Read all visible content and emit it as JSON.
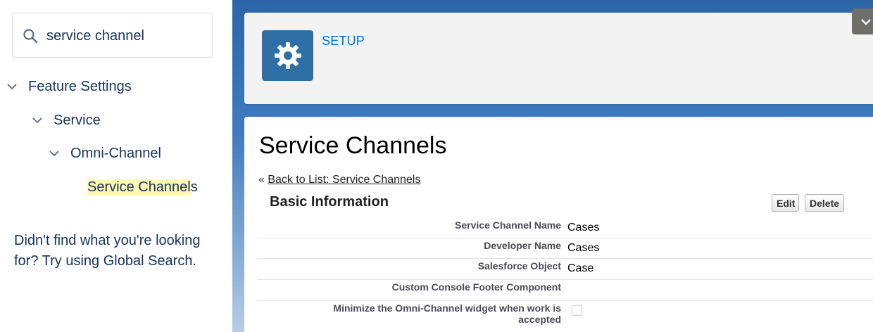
{
  "sidebar": {
    "search": {
      "value": "service channel",
      "placeholder": ""
    },
    "tree": {
      "level1": "Feature Settings",
      "level2": "Service",
      "level3": "Omni-Channel",
      "leaf_highlight": "Service Channel",
      "leaf_rest": "s"
    },
    "help_text": "Didn't find what you're looking for? Try using Global Search."
  },
  "header": {
    "setup_label": "SETUP"
  },
  "content": {
    "page_title": "Service Channels",
    "back_prefix": "« ",
    "back_link": "Back to List: Service Channels",
    "section_title": "Basic Information",
    "edit_label": "Edit",
    "delete_label": "Delete",
    "fields": [
      {
        "label": "Service Channel Name",
        "value": "Cases"
      },
      {
        "label": "Developer Name",
        "value": "Cases"
      },
      {
        "label": "Salesforce Object",
        "value": "Case"
      },
      {
        "label": "Custom Console Footer Component",
        "value": ""
      },
      {
        "label": "Minimize the Omni-Channel widget when work is accepted",
        "value": "",
        "checked": false
      }
    ]
  },
  "colors": {
    "accent": "#0070d2",
    "setup_tile": "#2e6fa5",
    "highlight": "#fdf9b2",
    "main_bg": "#2c65a8"
  }
}
